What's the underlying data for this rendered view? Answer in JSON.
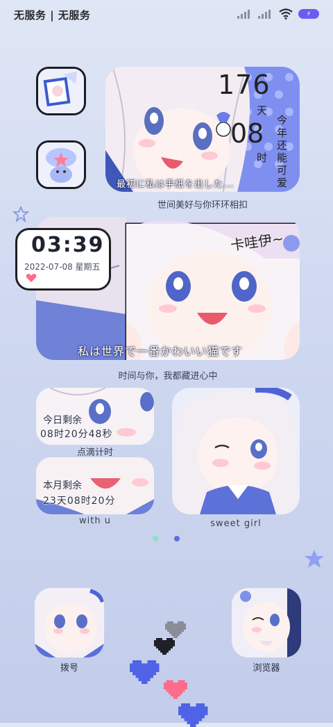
{
  "status_bar": {
    "carrier": "无服务 | 无服务",
    "battery_icon": "battery-charging-icon"
  },
  "widget_top": {
    "days_number": "176",
    "days_unit": "天",
    "hours_number": "08",
    "hours_unit": "时",
    "side_text": "今年还能可爱",
    "subtitle_overlay": "最初に私は手紙を出した...",
    "caption": "世间美好与你环环相扣"
  },
  "widget_clock": {
    "time": "03:39",
    "date": "2022-07-08 星期五",
    "bubble_text": "卡哇伊~",
    "subtitle_overlay": "私は世界で一番かわいい猫です",
    "caption": "时间与你，我都藏进心中"
  },
  "widget_countdown": {
    "today_label": "今日剩余",
    "today_value": "08时20分48秒",
    "today_caption": "点滴计时",
    "month_label": "本月剩余",
    "month_value": "23天08时20分",
    "month_caption": "with u"
  },
  "widget_girl": {
    "caption": "sweet girl"
  },
  "page_dots": {
    "active_color": "#5b6fe0",
    "inactive_color": "#8fe0c8"
  },
  "dock": {
    "app_left_label": "拨号",
    "app_right_label": "浏览器"
  },
  "colors": {
    "accent": "#6f7fe8",
    "heart_pink": "#ff6b8a",
    "heart_blue": "#4f63e6"
  }
}
